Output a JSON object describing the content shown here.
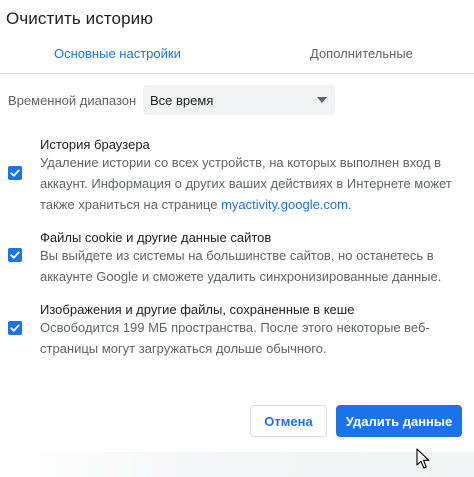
{
  "dialog": {
    "title": "Очистить историю"
  },
  "tabs": [
    {
      "label": "Основные настройки",
      "active": true
    },
    {
      "label": "Дополнительные",
      "active": false
    }
  ],
  "time_range": {
    "label": "Временной диапазон",
    "selected": "Все время"
  },
  "options": [
    {
      "title": "История браузера",
      "description": "Удаление истории со всех устройств, на которых выполнен вход в аккаунт. Информация о других ваших действиях в Интернете может также храниться на странице ",
      "link": "myactivity.google.com",
      "suffix": ".",
      "checked": true
    },
    {
      "title": "Файлы cookie и другие данные сайтов",
      "description": "Вы выйдете из системы на большинстве сайтов, но останетесь в аккаунте Google и сможете удалить синхронизированные данные.",
      "checked": true
    },
    {
      "title": "Изображения и другие файлы, сохраненные в кеше",
      "description": "Освободится 199 МБ пространства. После этого некоторые веб-страницы могут загружаться дольше обычного.",
      "checked": true
    }
  ],
  "buttons": {
    "cancel": "Отмена",
    "delete": "Удалить данные"
  },
  "colors": {
    "accent": "#1a73e8",
    "text_primary": "#202124",
    "text_secondary": "#5f6368",
    "select_bg": "#f1f3f4"
  },
  "icons": {
    "checkbox": "checkmark-icon",
    "dropdown": "caret-down-icon",
    "cursor": "mouse-pointer-icon"
  }
}
